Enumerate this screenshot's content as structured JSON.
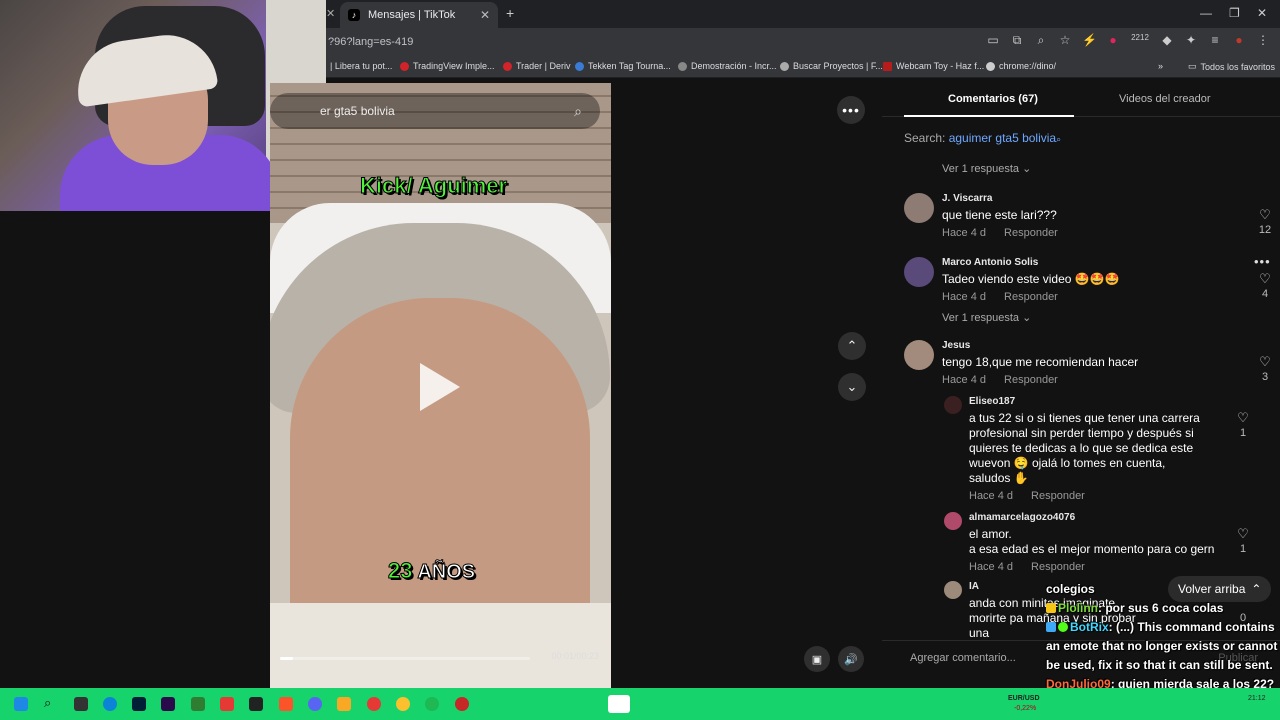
{
  "browser": {
    "tab_title": "Mensajes | TikTok",
    "url_fragment": "?96?lang=es-419",
    "badge_count": "2212",
    "bookmarks": [
      "| Libera tu pot...",
      "TradingView Imple...",
      "Trader | Deriv",
      "Tekken Tag Tourna...",
      "Demostración - Incr...",
      "Buscar Proyectos | F...",
      "Webcam Toy - Haz f...",
      "chrome://dino/",
      "Todos los favoritos"
    ]
  },
  "video": {
    "search_text": "er gta5 bolivia",
    "overlay_top": "Kick/ Aguimer",
    "overlay_num": "23",
    "overlay_word": "AÑOS",
    "time": "00:01/00:23",
    "progress": 0.05
  },
  "panel": {
    "tab_comments": "Comentarios (67)",
    "tab_creator": "Videos del creador",
    "search_prefix": "Search:",
    "search_term": "aguimer gta5 bolivia",
    "reply_toggle_1": "Ver 1 respuesta",
    "reply_toggle_2": "Ver 1 respuesta",
    "reply_word": "Responder",
    "comments": [
      {
        "name": "J. Viscarra",
        "text": "que tiene este lari???",
        "time": "Hace 4 d",
        "likes": "12"
      },
      {
        "name": "Marco Antonio Solis",
        "text": "Tadeo viendo este video 🤩🤩🤩",
        "time": "Hace 4 d",
        "likes": "4"
      },
      {
        "name": "Jesus",
        "text": "tengo 18,que me recomiendan hacer",
        "time": "Hace 4 d",
        "likes": "3"
      },
      {
        "name": "Eliseo187",
        "text": "a tus 22 si o si tienes que tener una carrera profesional sin perder tiempo y después si quieres te dedicas a lo que se dedica este wuevon 🤤 ojalá lo tomes en cuenta, saludos ✋",
        "time": "Hace 4 d",
        "likes": "1"
      },
      {
        "name": "almamarcelagozo4076",
        "text": "el amor.\na esa edad es el mejor momento para co gern",
        "time": "Hace 4 d",
        "likes": "1"
      },
      {
        "name": "IA",
        "text": "anda con minitas imaginate morirte pa mañana y sin probar una",
        "time": "",
        "likes": "0"
      }
    ],
    "add_comment": "Agregar comentario...",
    "publish": "Publicar",
    "back_top": "Volver arriba"
  },
  "chat": {
    "line0": "colegios",
    "user1": "Plolinn",
    "msg1": ": por sus 6 coca colas",
    "user2": "BotRix",
    "msg2": ": (...) This command contains an emote that no longer exists or cannot be used, fix it so that it can still be sent.",
    "user3": "DonJulio09",
    "msg3": ": quien mierda sale a los 22?"
  },
  "taskbar": {
    "fx_label": "EUR/USD",
    "fx_change": "-0,22%",
    "clock": "21:12"
  }
}
